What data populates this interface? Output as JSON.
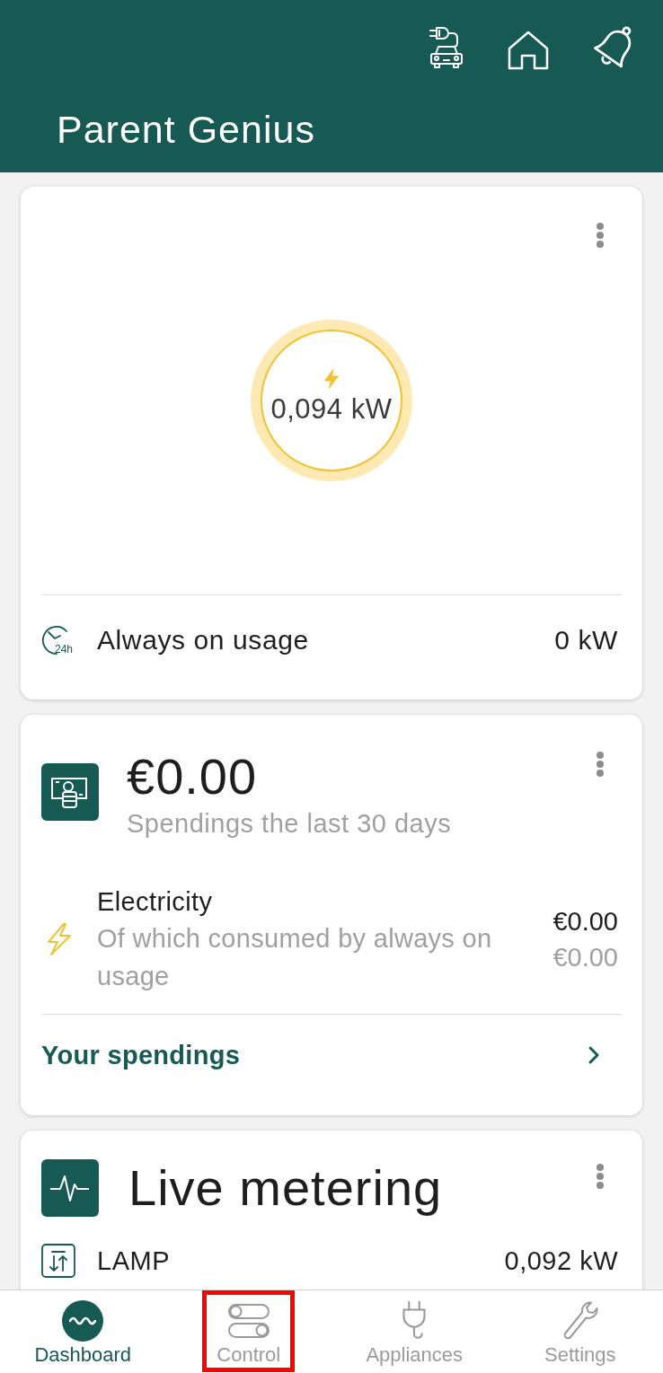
{
  "app_bar": {
    "title": "Parent Genius"
  },
  "power_card": {
    "reading": "0,094 kW",
    "always_on": {
      "badge": "24h",
      "label": "Always on usage",
      "value": "0 kW"
    }
  },
  "spendings_card": {
    "amount": "€0.00",
    "caption": "Spendings the last 30 days",
    "items": [
      {
        "label": "Electricity",
        "detail": "Of which consumed by always on usage",
        "amount": "€0.00",
        "detail_amount": "€0.00"
      }
    ],
    "link": "Your spendings"
  },
  "metering_card": {
    "title": "Live metering",
    "rows": [
      {
        "name": "LAMP",
        "reading": "0,092 kW"
      }
    ]
  },
  "nav": [
    {
      "kind": "dashboard",
      "label": "Dashboard",
      "selected": true,
      "highlighted": false
    },
    {
      "kind": "control",
      "label": "Control",
      "selected": false,
      "highlighted": true
    },
    {
      "kind": "appliances",
      "label": "Appliances",
      "selected": false,
      "highlighted": false
    },
    {
      "kind": "settings",
      "label": "Settings",
      "selected": false,
      "highlighted": false
    }
  ]
}
